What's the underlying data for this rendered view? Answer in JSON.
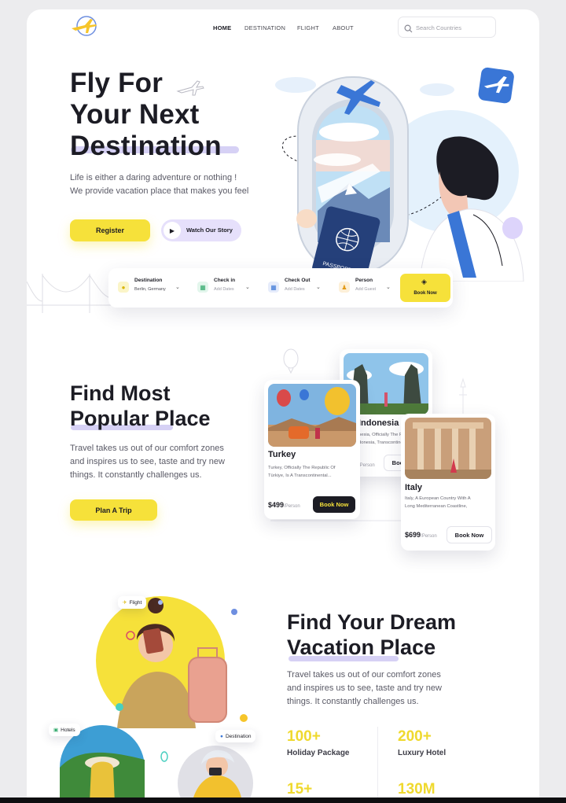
{
  "nav": {
    "links": [
      "HOME",
      "DESTINATION",
      "FLIGHT",
      "ABOUT"
    ],
    "search_placeholder": "Search Countries"
  },
  "hero": {
    "title_lines": [
      "Fly For",
      "Your Next",
      "Destination"
    ],
    "description_lines": [
      "Life is either a daring adventure or nothing !",
      "We provide vacation place that makes you feel"
    ],
    "register_label": "Register",
    "watch_label": "Watch Our Story",
    "passport_text": "PASSPORT"
  },
  "booking": {
    "destination_label": "Destination",
    "destination_value": "Berlin, Germany",
    "checkin_label": "Check in",
    "checkin_placeholder": "Add Dates",
    "checkout_label": "Check Out",
    "checkout_placeholder": "Add Dates",
    "person_label": "Person",
    "person_placeholder": "Add Guest",
    "book_label": "Book Now"
  },
  "popular": {
    "title_lines": [
      "Find Most",
      "Popular Place"
    ],
    "description_lines": [
      "Travel takes us out of our comfort zones",
      "and inspires us to see, taste and try new",
      "things. It constantly challenges us."
    ],
    "cta_label": "Plan A Trip",
    "cards": [
      {
        "name": "Turkey",
        "desc_lines": [
          "Turkey, Officially The Republic Of",
          "Türkiye, Is A Transcontinental..."
        ],
        "price": "$499",
        "per": "/Person",
        "button": "Book Now"
      },
      {
        "name": "Indonesia",
        "desc_lines": [
          "nesia, Officially The Republic",
          "donesia, Transcontinental..."
        ],
        "price": "",
        "per": "/Person",
        "button": "Book Now"
      },
      {
        "name": "Italy",
        "desc_lines": [
          "Italy, A European Country With A",
          "Long Mediterranean Coastline,"
        ],
        "price": "$699",
        "per": "/Person",
        "button": "Book Now"
      }
    ]
  },
  "dream": {
    "title_lines": [
      "Find Your Dream",
      "Vacation Place"
    ],
    "description_lines": [
      "Travel takes us out of our comfort zones",
      "and inspires us to see, taste and try new",
      "things. It constantly challenges us."
    ],
    "chips": {
      "flight": "Flight",
      "hotels": "Hotels",
      "destination": "Destination"
    },
    "stats": [
      {
        "value": "100+",
        "label": "Holiday Package"
      },
      {
        "value": "200+",
        "label": "Luxury Hotel"
      },
      {
        "value": "15+",
        "label": ""
      },
      {
        "value": "130M",
        "label": ""
      }
    ]
  },
  "colors": {
    "accent_yellow": "#f6e13a",
    "lavender": "#c8c1f2",
    "plane_blue": "#3a76d6",
    "text_dark": "#1c1c24"
  }
}
